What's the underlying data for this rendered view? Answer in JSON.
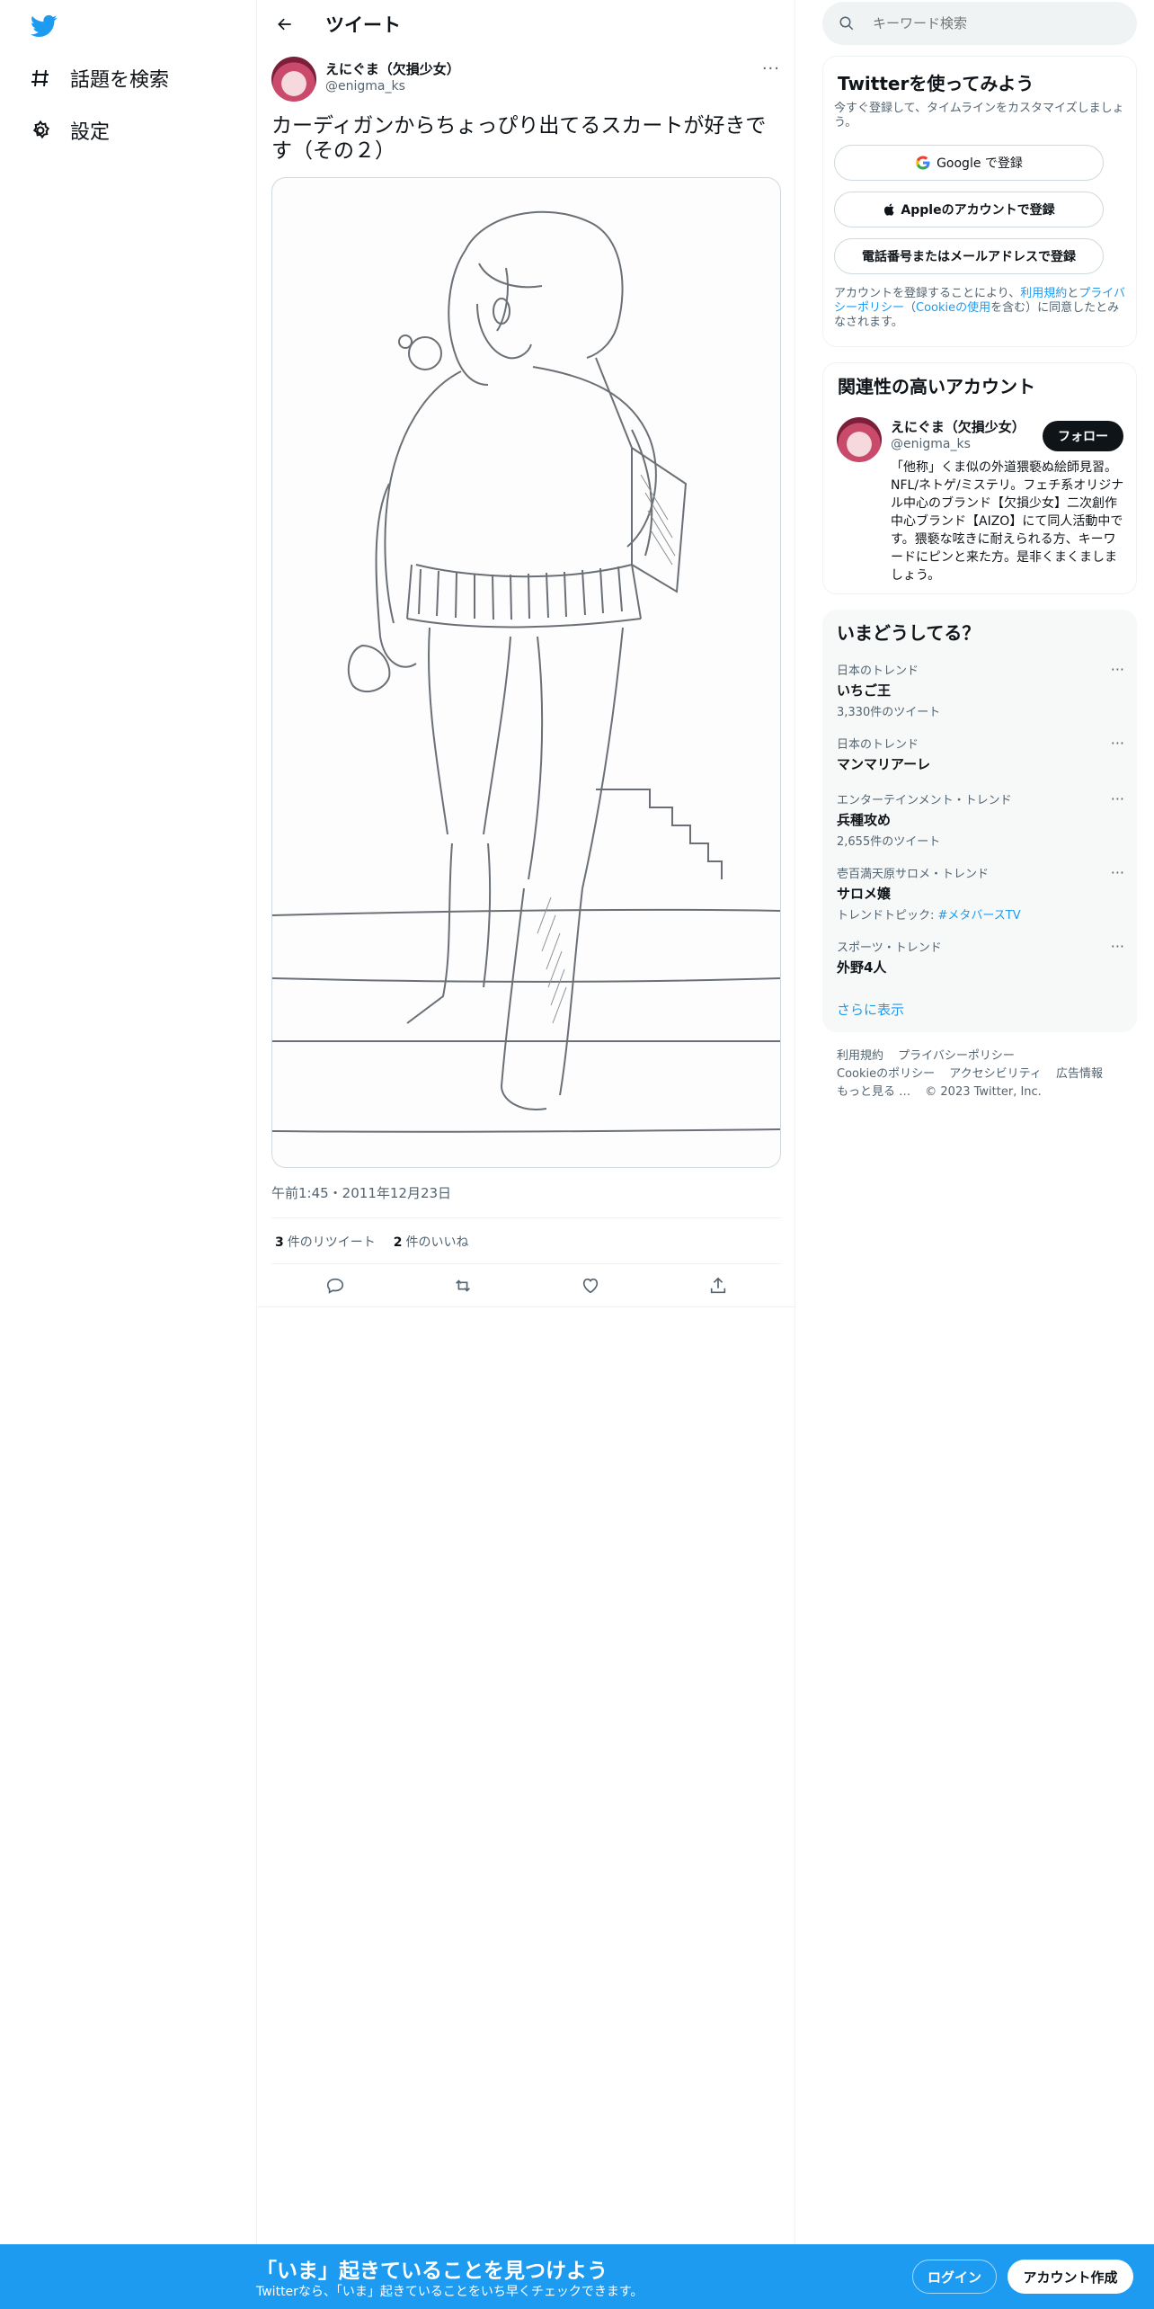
{
  "nav": {
    "items": [
      {
        "label": "話題を検索",
        "icon": "hashtag-icon"
      },
      {
        "label": "設定",
        "icon": "gear-icon"
      }
    ]
  },
  "header": {
    "title": "ツイート"
  },
  "tweet": {
    "author_name": "えにぐま（欠損少女）",
    "author_handle": "@enigma_ks",
    "text": "カーディガンからちょっぴり出てるスカートが好きです（その２）",
    "timestamp": "午前1:45・2011年12月23日",
    "retweets": "3",
    "retweets_label": "件のリツイート",
    "likes": "2",
    "likes_label": "件のいいね",
    "more": "···"
  },
  "search": {
    "placeholder": "キーワード検索"
  },
  "signup_card": {
    "title": "Twitterを使ってみよう",
    "subtitle": "今すぐ登録して、タイムラインをカスタマイズしましょう。",
    "google": "Google で登録",
    "apple": "Appleのアカウントで登録",
    "phone_email": "電話番号またはメールアドレスで登録",
    "legal_prefix": "アカウントを登録することにより、",
    "legal_terms": "利用規約",
    "legal_and": "と",
    "legal_privacy": "プライバシーポリシー",
    "legal_paren_open": "（",
    "legal_cookie": "Cookieの使用",
    "legal_suffix": "を含む）に同意したとみなされます。"
  },
  "related": {
    "title": "関連性の高いアカウント",
    "name": "えにぐま（欠損少女）",
    "handle": "@enigma_ks",
    "follow": "フォロー",
    "bio": "「他称」くま似の外道猥褻ぬ絵師見習。NFL/ネトゲ/ミステリ。フェチ系オリジナル中心のブランド【欠損少女】二次創作中心ブランド【AIZO】にて同人活動中です。猥褻な呟きに耐えられる方、キーワードにピンと来た方。是非くまくましましょう。"
  },
  "trends": {
    "title": "いまどうしてる？",
    "items": [
      {
        "meta": "日本のトレンド",
        "name": "いちご王",
        "count": "3,330件のツイート"
      },
      {
        "meta": "日本のトレンド",
        "name": "マンマリアーレ",
        "count": ""
      },
      {
        "meta": "エンターテインメント・トレンド",
        "name": "兵種攻め",
        "count": "2,655件のツイート"
      },
      {
        "meta": "壱百満天原サロメ・トレンド",
        "name": "サロメ嬢",
        "count_prefix": "トレンドトピック: ",
        "count_link": "#メタバースTV"
      },
      {
        "meta": "スポーツ・トレンド",
        "name": "外野4人",
        "count": ""
      }
    ],
    "dots": "···",
    "show_more": "さらに表示"
  },
  "footer": {
    "links": [
      "利用規約",
      "プライバシーポリシー",
      "Cookieのポリシー",
      "アクセシビリティ",
      "広告情報",
      "もっと見る …"
    ],
    "copyright": "© 2023 Twitter, Inc."
  },
  "bottom_bar": {
    "title": "「いま」起きていることを見つけよう",
    "subtitle": "Twitterなら、「いま」起きていることをいち早くチェックできます。",
    "login": "ログイン",
    "signup": "アカウント作成"
  },
  "colors": {
    "accent": "#1d9bf0",
    "text": "#0f1419",
    "muted": "#536471"
  }
}
